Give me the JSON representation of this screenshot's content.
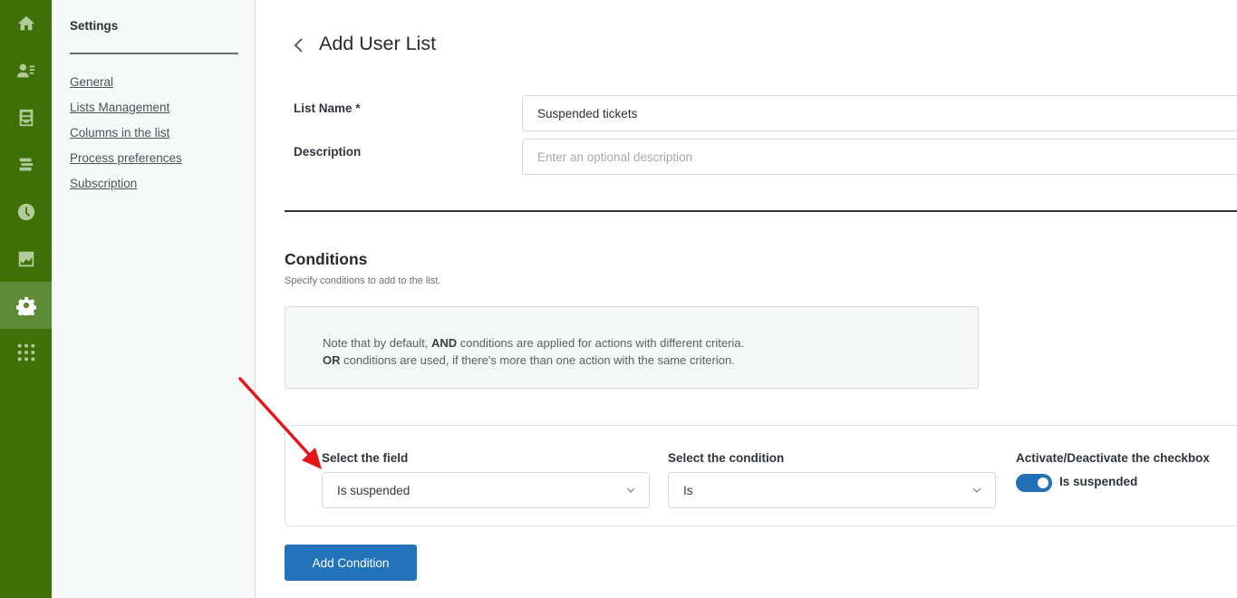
{
  "rail": {
    "items": [
      {
        "icon": "home-icon",
        "label": "Home"
      },
      {
        "icon": "contacts-icon",
        "label": "Contacts"
      },
      {
        "icon": "inbox-icon",
        "label": "Inbox"
      },
      {
        "icon": "lists-icon",
        "label": "Lists"
      },
      {
        "icon": "clock-icon",
        "label": "History"
      },
      {
        "icon": "chart-icon",
        "label": "Reports"
      },
      {
        "icon": "gear-icon",
        "label": "Settings",
        "active": true
      },
      {
        "icon": "apps-grid-icon",
        "label": "Apps"
      }
    ],
    "colors": {
      "background": "#3f7007",
      "active": "#5e8b36",
      "icon": "#b3cb9a"
    }
  },
  "sidenav": {
    "title": "Settings",
    "links": [
      "General",
      "Lists Management",
      "Columns in the list",
      "Process preferences",
      "Subscription"
    ]
  },
  "page": {
    "title": "Add User List",
    "back_icon": "chevron-left-icon"
  },
  "form": {
    "list_name_label": "List Name *",
    "list_name_value": "Suspended tickets",
    "description_label": "Description",
    "description_value": "",
    "description_placeholder": "Enter an optional description"
  },
  "conditions": {
    "title": "Conditions",
    "subtitle": "Specify conditions to add to the list.",
    "note": {
      "line1_bold": "AND",
      "line1_pre": "Note that by default, ",
      "line1_post": " conditions are applied for actions with different criteria.",
      "line2_bold": "OR",
      "line2_post": " conditions are used, if there's more than one action with the same criterion."
    },
    "condition": {
      "field_label": "Select the field",
      "field_value": "Is suspended",
      "condition_label": "Select the condition",
      "condition_value": "Is",
      "checkbox_label": "Activate/Deactivate the checkbox",
      "toggle_on": true,
      "toggle_text": "Is suspended"
    },
    "add_button": "Add Condition"
  },
  "annotation": {
    "type": "arrow",
    "color": "#e8141b",
    "points_to": "select-field-label"
  },
  "colors": {
    "primary": "#2273b9",
    "toggle": "#2271b8"
  }
}
